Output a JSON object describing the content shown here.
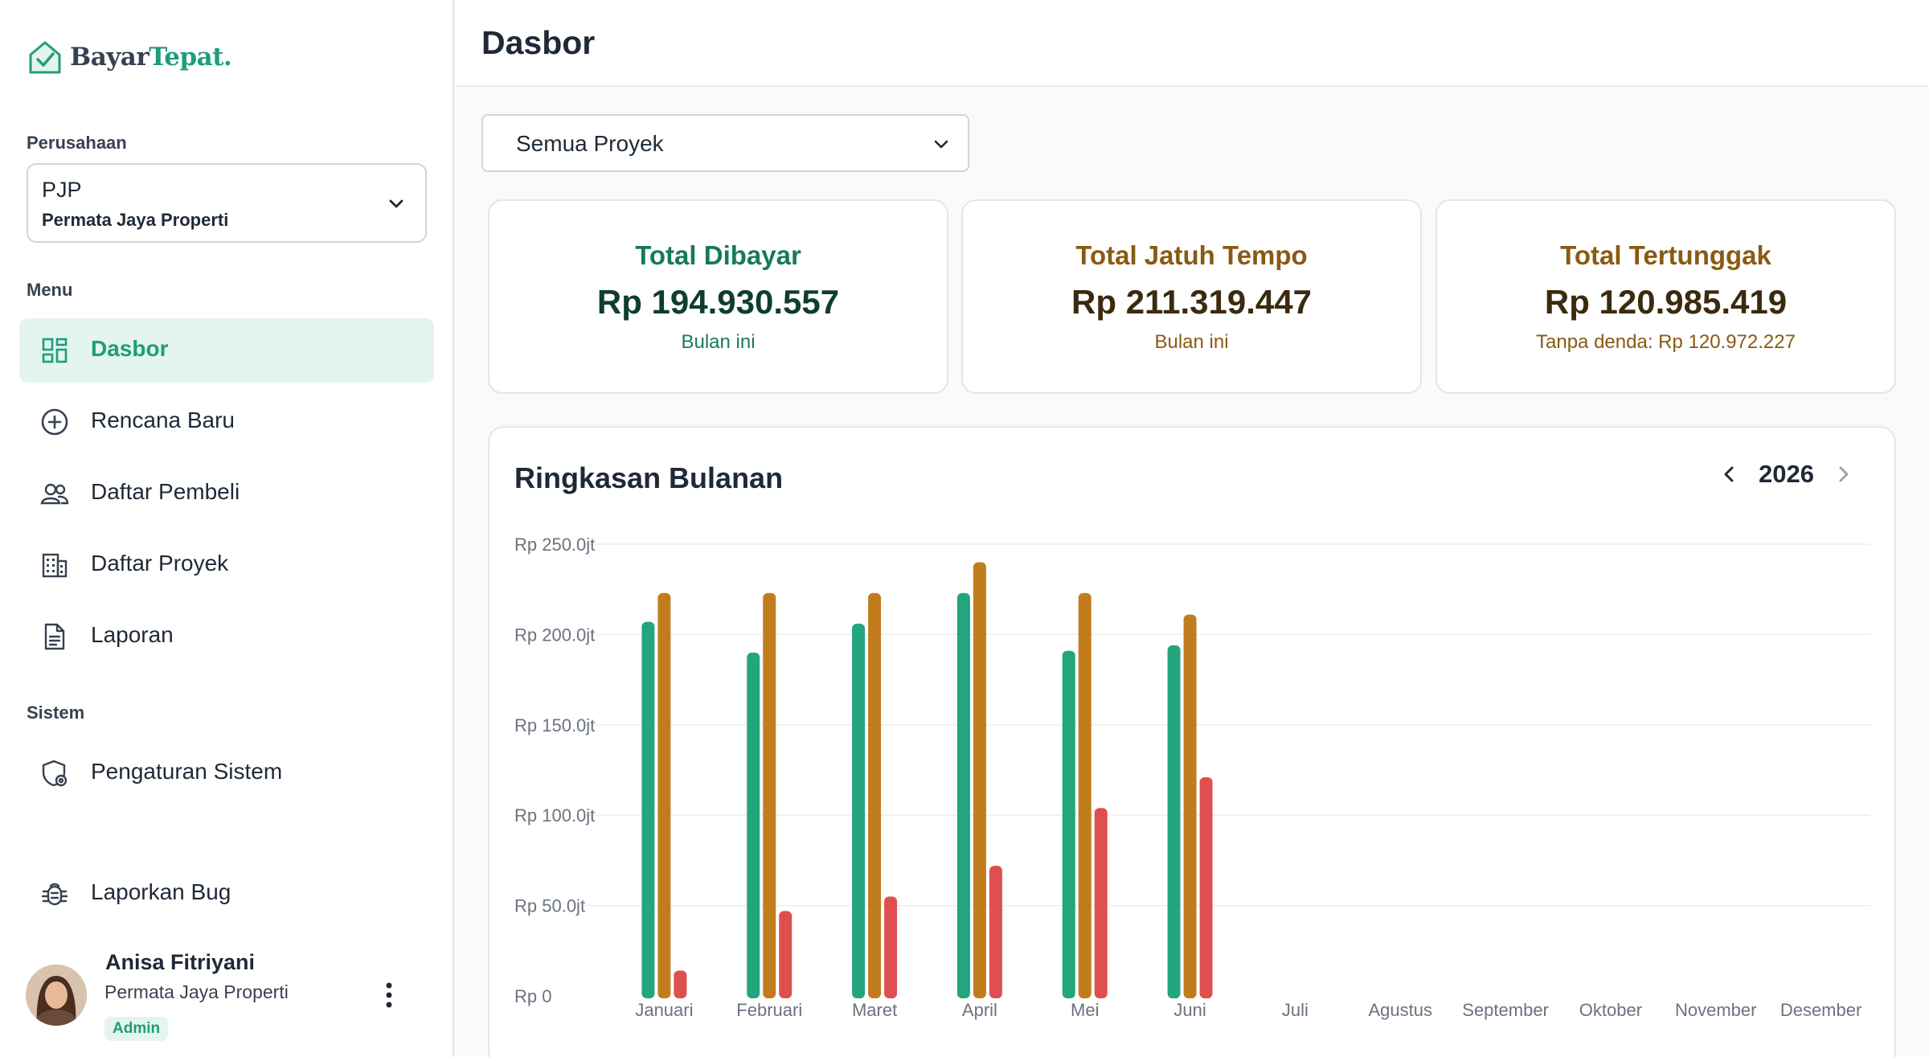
{
  "app": {
    "logo_part1": "Bayar",
    "logo_part2": "Tepat."
  },
  "sidebar": {
    "company_label": "Perusahaan",
    "company_code": "PJP",
    "company_name": "Permata Jaya Properti",
    "menu_label": "Menu",
    "system_label": "Sistem",
    "items": [
      {
        "label": "Dasbor",
        "icon": "dashboard-icon",
        "active": true
      },
      {
        "label": "Rencana Baru",
        "icon": "plus-circle-icon"
      },
      {
        "label": "Daftar Pembeli",
        "icon": "users-icon"
      },
      {
        "label": "Daftar Proyek",
        "icon": "building-icon"
      },
      {
        "label": "Laporan",
        "icon": "document-icon"
      }
    ],
    "system_items": [
      {
        "label": "Pengaturan Sistem",
        "icon": "settings-shield-icon"
      }
    ],
    "bug_item": {
      "label": "Laporkan Bug",
      "icon": "bug-icon"
    },
    "user": {
      "name": "Anisa Fitriyani",
      "company": "Permata Jaya Properti",
      "role": "Admin"
    }
  },
  "header": {
    "title": "Dasbor"
  },
  "filter": {
    "project_value": "Semua Proyek"
  },
  "cards": {
    "paid": {
      "title": "Total Dibayar",
      "value": "Rp 194.930.557",
      "sub": "Bulan ini"
    },
    "due": {
      "title": "Total Jatuh Tempo",
      "value": "Rp 211.319.447",
      "sub": "Bulan ini"
    },
    "overdue": {
      "title": "Total Tertunggak",
      "value": "Rp 120.985.419",
      "sub": "Tanpa denda: Rp 120.972.227"
    }
  },
  "chart_header": {
    "title": "Ringkasan Bulanan",
    "year": "2026"
  },
  "colors": {
    "paid": "#23a57d",
    "due": "#c17d1d",
    "overdue": "#e04f4f",
    "accent": "#1f9d7a"
  },
  "chart_data": {
    "type": "bar",
    "title": "Ringkasan Bulanan",
    "ylim": [
      0,
      250
    ],
    "y_ticks": [
      "Rp 0",
      "Rp 50.0jt",
      "Rp 100.0jt",
      "Rp 150.0jt",
      "Rp 200.0jt",
      "Rp 250.0jt"
    ],
    "y_tick_values": [
      0,
      50,
      100,
      150,
      200,
      250
    ],
    "grid": true,
    "categories": [
      "Januari",
      "Februari",
      "Maret",
      "April",
      "Mei",
      "Juni",
      "Juli",
      "Agustus",
      "September",
      "Oktober",
      "November",
      "Desember"
    ],
    "series": [
      {
        "key": "paid",
        "values": [
          207,
          190,
          206,
          223,
          191,
          194,
          null,
          null,
          null,
          null,
          null,
          null
        ]
      },
      {
        "key": "due",
        "values": [
          223,
          223,
          223,
          240,
          223,
          211,
          null,
          null,
          null,
          null,
          null,
          null
        ]
      },
      {
        "key": "overdue",
        "values": [
          14,
          47,
          55,
          72,
          104,
          121,
          null,
          null,
          null,
          null,
          null,
          null
        ]
      }
    ]
  }
}
